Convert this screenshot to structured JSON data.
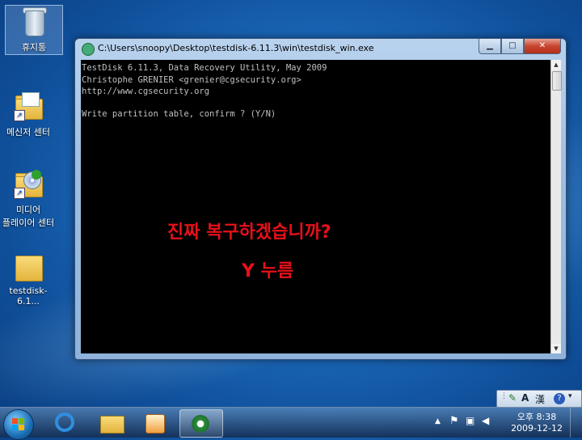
{
  "desktop": {
    "icons": [
      {
        "label": "휴지통"
      },
      {
        "label": "메신저 센터"
      },
      {
        "label": "미디어",
        "label2": "플레이어 센터"
      },
      {
        "label": "testdisk-6.1..."
      }
    ]
  },
  "window": {
    "title": "C:\\Users\\snoopy\\Desktop\\testdisk-6.11.3\\win\\testdisk_win.exe",
    "buttons": {
      "minimize": "▁",
      "maximize": "□",
      "close": "✕"
    }
  },
  "console": {
    "lines": [
      "TestDisk 6.11.3, Data Recovery Utility, May 2009",
      "Christophe GRENIER <grenier@cgsecurity.org>",
      "http://www.cgsecurity.org",
      "Write partition table, confirm ? (Y/N)"
    ]
  },
  "annotation": {
    "line1": "진짜 복구하겠습니까?",
    "line2": "Y 누름"
  },
  "ime_bar": {
    "mode": "A",
    "hanja": "漢",
    "help": "?"
  },
  "taskbar": {
    "clock": {
      "time": "오후 8:38",
      "date": "2009-12-12"
    }
  }
}
